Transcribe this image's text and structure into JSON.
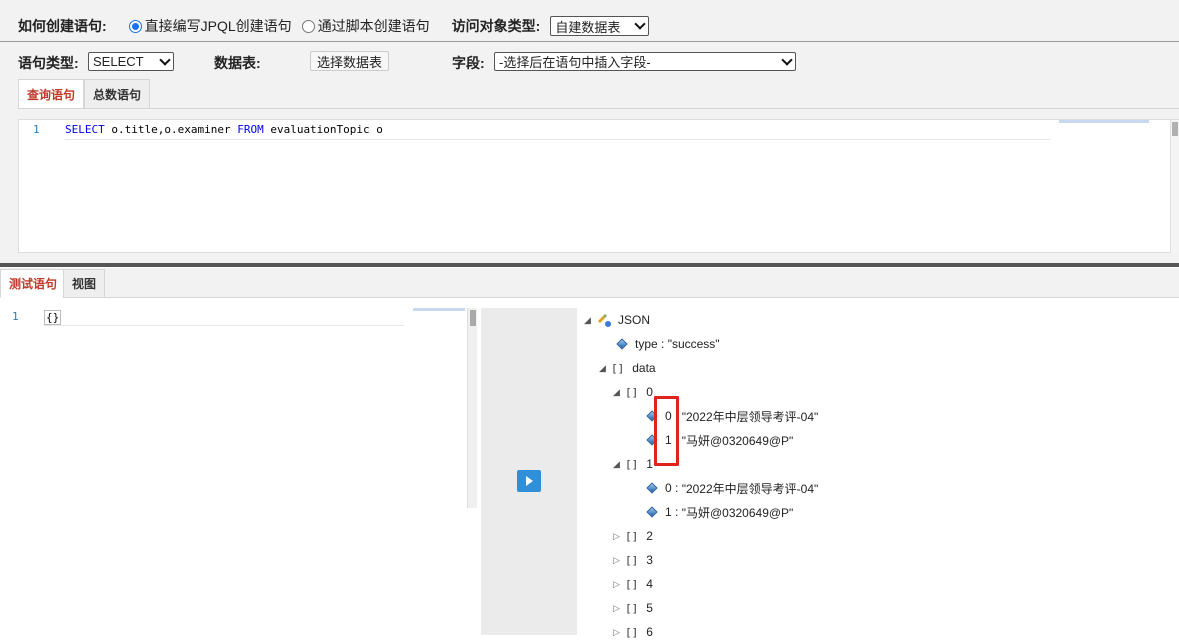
{
  "config": {
    "how_create_label": "如何创建语句:",
    "radio_jpql_label": "直接编写JPQL创建语句",
    "radio_script_label": "通过脚本创建语句",
    "access_type_label": "访问对象类型:",
    "access_type_value": "自建数据表",
    "stmt_type_label": "语句类型:",
    "stmt_type_value": "SELECT",
    "table_label": "数据表:",
    "choose_table_button": "选择数据表",
    "field_label": "字段:",
    "field_value": "-选择后在语句中插入字段-"
  },
  "query_tabs": [
    "查询语句",
    "总数语句"
  ],
  "query_editor": {
    "line_number": "1",
    "code_kw1": "SELECT",
    "code_mid": " o.title,o.examiner ",
    "code_kw2": "FROM",
    "code_tail": " evaluationTopic o"
  },
  "test_tabs": [
    "测试语句",
    "视图"
  ],
  "test_editor": {
    "line_number": "1",
    "code": "{}"
  },
  "tree": {
    "root": "JSON",
    "type_key": "type",
    "type_value": "\"success\"",
    "data_key": "data",
    "bracket": "[]",
    "items": [
      {
        "index": "0",
        "children": [
          {
            "key": "0",
            "value": "\"2022年中层领导考评-04\""
          },
          {
            "key": "1",
            "value": "\"马妍@0320649@P\""
          }
        ]
      },
      {
        "index": "1",
        "children": [
          {
            "key": "0",
            "value": "\"2022年中层领导考评-04\""
          },
          {
            "key": "1",
            "value": "\"马妍@0320649@P\""
          }
        ]
      },
      {
        "index": "2"
      },
      {
        "index": "3"
      },
      {
        "index": "4"
      },
      {
        "index": "5"
      },
      {
        "index": "6"
      }
    ]
  },
  "colors": {
    "accent": "#2f8fd8",
    "active_tab_text": "#c0392b",
    "highlight_box": "#e0241b"
  }
}
